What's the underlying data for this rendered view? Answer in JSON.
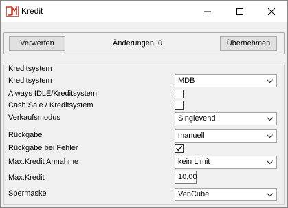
{
  "window": {
    "title": "Kredit"
  },
  "toolbar": {
    "discard_label": "Verwerfen",
    "changes_text": "Änderungen: 0",
    "apply_label": "Übernehmen"
  },
  "group": {
    "title": "Kreditsystem"
  },
  "fields": {
    "kreditsystem": {
      "label": "Kreditsystem",
      "value": "MDB"
    },
    "always_idle": {
      "label": "Always IDLE/Kreditsystem",
      "checked": false
    },
    "cash_sale": {
      "label": "Cash Sale / Kreditsystem",
      "checked": false
    },
    "verkaufsmodus": {
      "label": "Verkaufsmodus",
      "value": "Singlevend"
    },
    "rueckgabe": {
      "label": "Rückgabe",
      "value": "manuell"
    },
    "rueckgabe_fehler": {
      "label": "Rückgabe bei Fehler",
      "checked": true
    },
    "max_kredit_annahme": {
      "label": "Max.Kredit Annahme",
      "value": "kein Limit"
    },
    "max_kredit": {
      "label": "Max.Kredit",
      "value": "10,00"
    },
    "spermaske": {
      "label": "Spermaske",
      "value": "VenCube"
    }
  },
  "icons": {
    "app": "jm-logo-icon",
    "minimize": "minimize-icon",
    "maximize": "maximize-icon",
    "close": "close-icon",
    "dropdown": "chevron-down-icon",
    "check": "checkmark-icon"
  },
  "colors": {
    "accent": "#c0392b",
    "titlebar": "#ffffff",
    "window_bg": "#f0f0f0"
  }
}
